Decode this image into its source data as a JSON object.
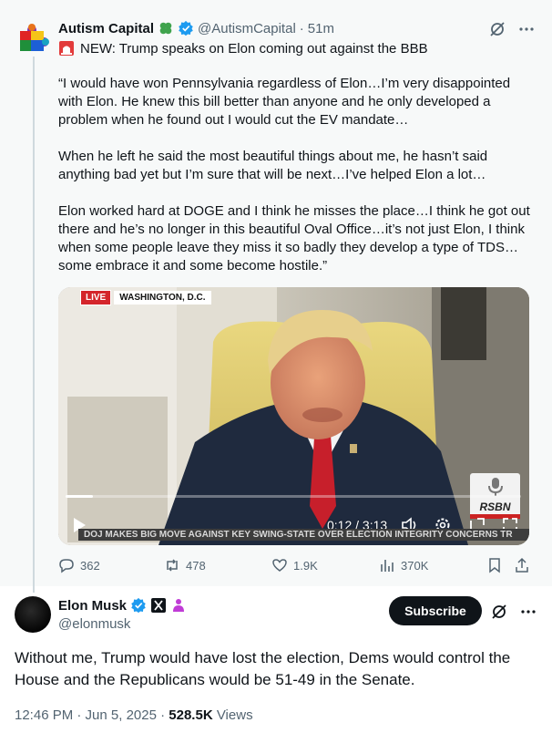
{
  "quoted_post": {
    "author_name": "Autism Capital",
    "handle": "@AutismCapital",
    "separator": "·",
    "time": "51m",
    "headline": "NEW: Trump speaks on Elon coming out against the BBB",
    "paragraphs": [
      "“I would have won Pennsylvania regardless of Elon…I’m very disappointed with Elon. He knew this bill better than anyone and he only developed a problem when he found out I would cut the EV mandate…",
      "When he left he said the most beautiful things about me, he hasn’t said anything bad yet but I’m sure that will be next…I’ve helped Elon a lot…",
      "Elon worked hard at DOGE and I think he misses the place…I think he got out there and he’s no longer in this beautiful Oval Office…it’s not just Elon, I think when some people leave they miss it so badly they develop a type of TDS…some embrace it and some become hostile.”"
    ],
    "video": {
      "live_label": "LIVE",
      "location": "WASHINGTON, D.C.",
      "ticker": "DOJ MAKES BIG MOVE AGAINST KEY SWING-STATE OVER ELECTION INTEGRITY CONCERNS   TR",
      "watermark": "RSBN",
      "timecode": "0:12 / 3:13",
      "progress_fraction": 0.06
    },
    "stats": {
      "replies": "362",
      "reposts": "478",
      "likes": "1.9K",
      "views": "370K"
    }
  },
  "main_post": {
    "author_name": "Elon Musk",
    "handle": "@elonmusk",
    "subscribe_label": "Subscribe",
    "text": "Without me, Trump would have lost the election, Dems would control the House and the Republicans would be 51-49 in the Senate.",
    "timestamp": "12:46 PM · Jun 5, 2025 ·",
    "views_count": "528.5K",
    "views_label": "Views"
  },
  "colors": {
    "verified_blue": "#1d9bf0",
    "text_primary": "#0f1419",
    "text_secondary": "#536471",
    "quoted_bg": "#f7f9f9",
    "live_red": "#d4252b"
  }
}
